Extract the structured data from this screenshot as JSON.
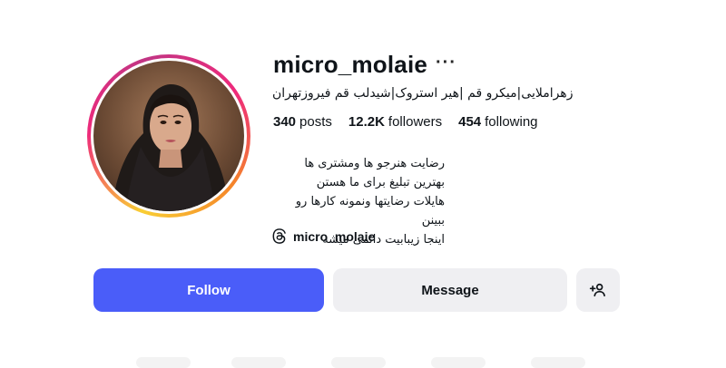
{
  "profile": {
    "username": "micro_molaie",
    "more_label": "···",
    "full_name": "زهراملایی|میکرو قم |هیر استروک|شیدلب قم فیروزتهران",
    "stats": {
      "posts_count": "340",
      "posts_label": "posts",
      "followers_count": "12.2K",
      "followers_label": "followers",
      "following_count": "454",
      "following_label": "following"
    },
    "bio_lines": [
      "رضایت هنرجو ها ومشتری ها",
      "بهترین تبلیغ برای ما هستن",
      "هایلات رضایتها ونمونه کارها رو ببینن",
      "اینجا زیبابیت دائمی میشه"
    ],
    "threads_handle": "micro_molaie"
  },
  "actions": {
    "follow_label": "Follow",
    "message_label": "Message",
    "add_icon": "person-plus-icon"
  },
  "colors": {
    "follow_bg": "#4a5df9",
    "secondary_bg": "#efeff2",
    "text": "#0f1419"
  }
}
